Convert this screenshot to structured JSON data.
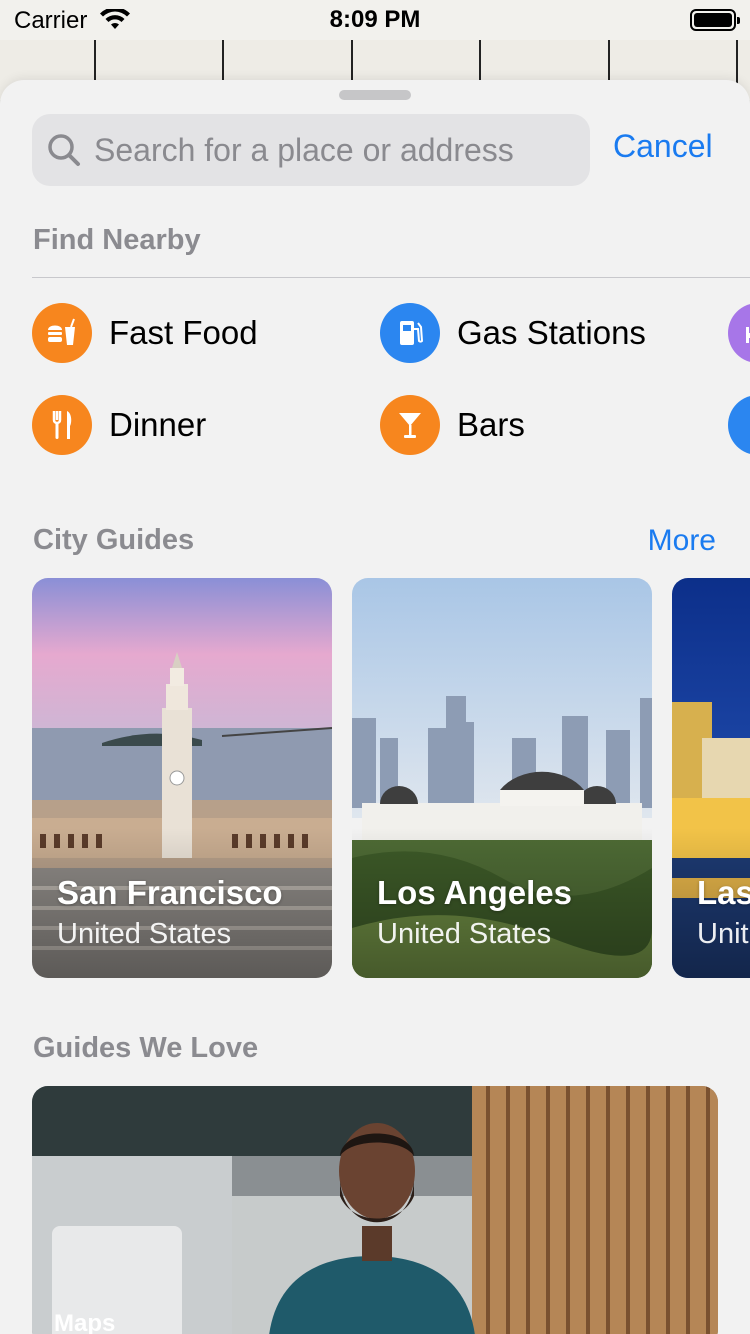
{
  "status_bar": {
    "carrier": "Carrier",
    "time": "8:09 PM"
  },
  "search": {
    "placeholder": "Search for a place or address",
    "cancel_label": "Cancel"
  },
  "find_nearby": {
    "title": "Find Nearby",
    "categories": [
      {
        "label": "Fast Food",
        "icon": "fast-food-icon",
        "color": "#f7861e"
      },
      {
        "label": "Gas Stations",
        "icon": "gas-station-icon",
        "color": "#2b86f0"
      },
      {
        "label": "",
        "icon": "hotel-icon",
        "color": "#a776e8"
      },
      {
        "label": "Dinner",
        "icon": "dinner-icon",
        "color": "#f7861e"
      },
      {
        "label": "Bars",
        "icon": "bar-icon",
        "color": "#f7861e"
      },
      {
        "label": "",
        "icon": "category-icon",
        "color": "#2b86f0"
      }
    ]
  },
  "city_guides": {
    "title": "City Guides",
    "more_label": "More",
    "cities": [
      {
        "name": "San Francisco",
        "country": "United States"
      },
      {
        "name": "Los Angeles",
        "country": "United States"
      },
      {
        "name": "Las",
        "country": "Unit"
      }
    ]
  },
  "guides_we_love": {
    "title": "Guides We Love",
    "brand": "Maps"
  },
  "colors": {
    "accent": "#1a7bf0",
    "orange": "#f7861e",
    "blue": "#2b86f0",
    "purple": "#a776e8"
  }
}
